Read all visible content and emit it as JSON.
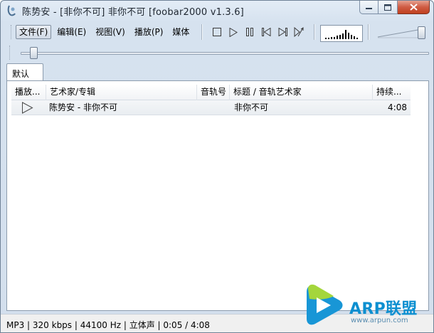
{
  "window": {
    "title": "陈势安 - [非你不可] 非你不可   [foobar2000 v1.3.6]"
  },
  "menu": {
    "items": [
      {
        "label": "文件(F)",
        "active": true
      },
      {
        "label": "编辑(E)",
        "active": false
      },
      {
        "label": "视图(V)",
        "active": false
      },
      {
        "label": "播放(P)",
        "active": false
      },
      {
        "label": "媒体",
        "active": false
      }
    ]
  },
  "transport": {
    "buttons": [
      "stop-icon",
      "play-icon",
      "pause-icon",
      "previous-icon",
      "next-icon",
      "random-icon"
    ]
  },
  "visualizer": {
    "bars": [
      0.15,
      0.15,
      0.2,
      0.2,
      0.3,
      0.35,
      0.5,
      0.8,
      0.55,
      0.35,
      0.25,
      0.15
    ]
  },
  "volume": {
    "level": 0.9
  },
  "seek": {
    "position": 0.02
  },
  "tabs": [
    {
      "label": "默认"
    }
  ],
  "playlist": {
    "columns": [
      {
        "label": "播放..."
      },
      {
        "label": "艺术家/专辑"
      },
      {
        "label": "音轨号"
      },
      {
        "label": "标题 / 音轨艺术家"
      },
      {
        "label": "持续..."
      }
    ],
    "rows": [
      {
        "artist_album": "陈势安 - 非你不可",
        "track_no": "",
        "title": "非你不可",
        "duration": "4:08"
      }
    ]
  },
  "statusbar": {
    "text": "MP3 | 320 kbps | 44100 Hz | 立体声 | 0:05 / 4:08"
  },
  "watermark": {
    "name": "ARP联盟",
    "url": "www.arpun.com",
    "colors": {
      "blue": "#0c8fd0",
      "green": "#6abf2a"
    }
  }
}
